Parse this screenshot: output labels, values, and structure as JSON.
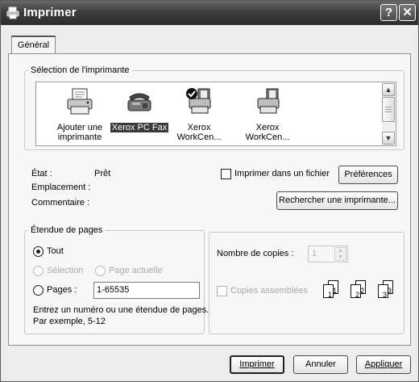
{
  "window": {
    "title": "Imprimer",
    "help_glyph": "?",
    "close_glyph": "✕"
  },
  "tabs": [
    {
      "label": "Général"
    }
  ],
  "printer_selection": {
    "legend": "Sélection de l'imprimante",
    "printers": [
      {
        "label_line1": "Ajouter une",
        "label_line2": "imprimante",
        "icon": "add-printer-icon",
        "selected": false
      },
      {
        "label_line1": "Xerox PC Fax",
        "label_line2": "",
        "icon": "fax-icon",
        "selected": true
      },
      {
        "label_line1": "Xerox",
        "label_line2": "WorkCen...",
        "icon": "default-printer-icon",
        "selected": false
      },
      {
        "label_line1": "Xerox",
        "label_line2": "WorkCen...",
        "icon": "printer-icon",
        "selected": false
      }
    ],
    "status_label": "État :",
    "status_value": "Prêt",
    "location_label": "Emplacement :",
    "location_value": "",
    "comment_label": "Commentaire :",
    "comment_value": "",
    "print_to_file_label": "Imprimer dans un fichier",
    "print_to_file_checked": false,
    "preferences_button": "Préférences",
    "find_printer_button": "Rechercher une imprimante..."
  },
  "page_range": {
    "legend": "Étendue de pages",
    "all_label": "Tout",
    "selection_label": "Sélection",
    "current_page_label": "Page actuelle",
    "pages_label": "Pages :",
    "pages_value": "1-65535",
    "help_line1": "Entrez un numéro ou une étendue de pages.",
    "help_line2": "Par exemple, 5-12",
    "selected_option": "all"
  },
  "copies": {
    "count_label": "Nombre de copies :",
    "count_value": "1",
    "collate_label": "Copies assemblées",
    "collate_checked": false,
    "collate_sheet_labels": [
      "1",
      "1",
      "2",
      "2",
      "3",
      "3"
    ]
  },
  "buttons": {
    "print": "Imprimer",
    "cancel": "Annuler",
    "apply": "Appliquer"
  },
  "colors": {
    "titlebar": "#3d3d3d",
    "selection_highlight": "#3a3a3a",
    "dialog_bg": "#ececec",
    "panel_bg": "#f7f7f7"
  }
}
